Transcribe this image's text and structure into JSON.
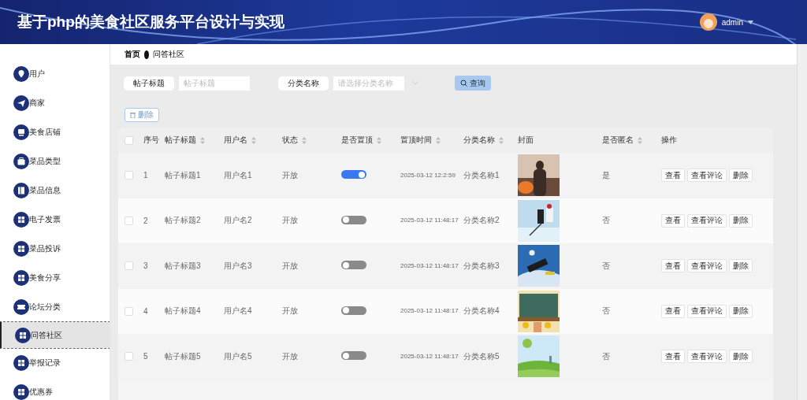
{
  "header": {
    "title": "基于php的美食社区服务平台设计与实现",
    "user": "admin"
  },
  "sidebar": {
    "items": [
      {
        "label": "用户",
        "selected": false
      },
      {
        "label": "商家",
        "selected": false
      },
      {
        "label": "美食店铺",
        "selected": false
      },
      {
        "label": "菜品类型",
        "selected": false
      },
      {
        "label": "菜品信息",
        "selected": false
      },
      {
        "label": "电子发票",
        "selected": false
      },
      {
        "label": "菜品投诉",
        "selected": false
      },
      {
        "label": "美食分享",
        "selected": false
      },
      {
        "label": "论坛分类",
        "selected": false
      },
      {
        "label": "问答社区",
        "selected": true
      },
      {
        "label": "举报记录",
        "selected": false
      },
      {
        "label": "优惠券",
        "selected": false
      }
    ]
  },
  "breadcrumb": [
    "首页",
    "问答社区"
  ],
  "search": {
    "fields": [
      {
        "label": "帖子标题",
        "placeholder": "帖子标题",
        "kind": "input"
      },
      {
        "label": "分类名称",
        "placeholder": "请选择分类名称",
        "kind": "select"
      }
    ],
    "button": "查询"
  },
  "toolbar": {
    "delete": "删除"
  },
  "table": {
    "all_checked": false,
    "columns": [
      {
        "label": "序号",
        "sortable": false
      },
      {
        "label": "帖子标题",
        "sortable": true
      },
      {
        "label": "用户名",
        "sortable": true
      },
      {
        "label": "状态",
        "sortable": true
      },
      {
        "label": "是否置顶",
        "sortable": true
      },
      {
        "label": "置顶时间",
        "sortable": true
      },
      {
        "label": "分类名称",
        "sortable": true
      },
      {
        "label": "封面",
        "sortable": false
      },
      {
        "label": "是否匿名",
        "sortable": true
      },
      {
        "label": "操作",
        "sortable": false
      }
    ],
    "rows": [
      {
        "checked": false,
        "index": "1",
        "title": "帖子标题1",
        "user": "用户名1",
        "status": "开放",
        "pinned": true,
        "time": "2025-03-12 12:2:59",
        "category": "分类名称1",
        "anonymous": "是",
        "actions": [
          "查看",
          "查看评论",
          "删除"
        ]
      },
      {
        "checked": false,
        "index": "2",
        "title": "帖子标题2",
        "user": "用户名2",
        "status": "开放",
        "pinned": false,
        "time": "2025-03-12 11:48:17",
        "category": "分类名称2",
        "anonymous": "否",
        "actions": [
          "查看",
          "查看评论",
          "删除"
        ]
      },
      {
        "checked": false,
        "index": "3",
        "title": "帖子标题3",
        "user": "用户名3",
        "status": "开放",
        "pinned": false,
        "time": "2025-03-12 11:48:17",
        "category": "分类名称3",
        "anonymous": "否",
        "actions": [
          "查看",
          "查看评论",
          "删除"
        ]
      },
      {
        "checked": false,
        "index": "4",
        "title": "帖子标题4",
        "user": "用户名4",
        "status": "开放",
        "pinned": false,
        "time": "2025-03-12 11:48:17",
        "category": "分类名称4",
        "anonymous": "否",
        "actions": [
          "查看",
          "查看评论",
          "删除"
        ]
      },
      {
        "checked": false,
        "index": "5",
        "title": "帖子标题5",
        "user": "用户名5",
        "status": "开放",
        "pinned": false,
        "time": "2025-03-12 11:48:17",
        "category": "分类名称5",
        "anonymous": "否",
        "actions": [
          "查看",
          "查看评论",
          "删除"
        ]
      }
    ]
  }
}
